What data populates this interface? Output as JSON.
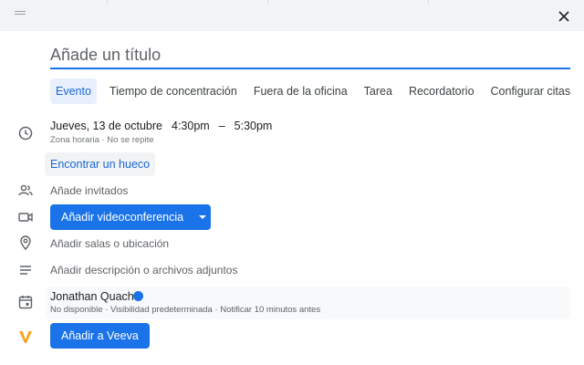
{
  "title_input": {
    "placeholder": "Añade un título"
  },
  "tabs": [
    {
      "label": "Evento"
    },
    {
      "label": "Tiempo de concentración"
    },
    {
      "label": "Fuera de la oficina"
    },
    {
      "label": "Tarea"
    },
    {
      "label": "Recordatorio"
    },
    {
      "label": "Configurar citas"
    }
  ],
  "datetime": {
    "date": "Jueves, 13 de octubre",
    "start": "4:30pm",
    "separator": "–",
    "end": "5:30pm",
    "subline": "Zona horaria · No se repite"
  },
  "find_slot_label": "Encontrar un hueco",
  "guests_label": "Añade invitados",
  "video_button_label": "Añadir videoconferencia",
  "location_label": "Añadir salas o ubicación",
  "description_label": "Añadir descripción o archivos adjuntos",
  "calendar": {
    "owner": "Jonathan Quach",
    "details": "No disponible · Visibilidad predeterminada · Notificar 10 minutos antes",
    "color": "#1a73e8"
  },
  "veeva_button_label": "Añadir a Veeva",
  "colors": {
    "accent": "#1a73e8",
    "veeva": "#f5a623"
  },
  "icons": [
    "drag-handle-icon",
    "close-icon",
    "clock-icon",
    "people-icon",
    "video-icon",
    "location-pin-icon",
    "description-lines-icon",
    "calendar-icon",
    "veeva-logo-icon",
    "chevron-down-icon"
  ]
}
